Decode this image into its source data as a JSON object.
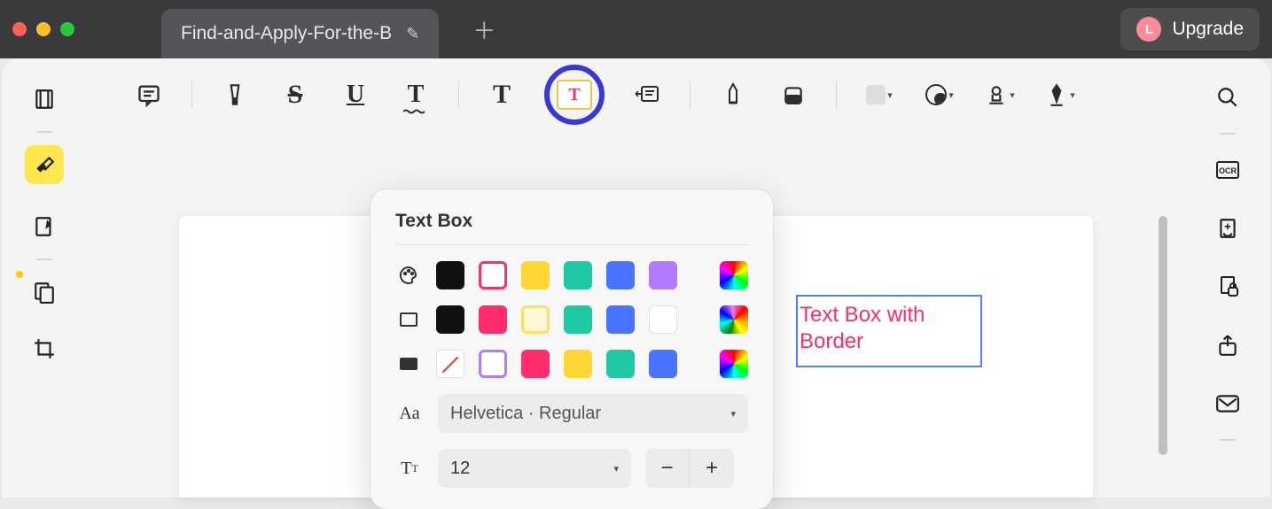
{
  "window": {
    "tab_title": "Find-and-Apply-For-the-B",
    "upgrade_label": "Upgrade",
    "avatar_letter": "L"
  },
  "popover": {
    "title": "Text Box",
    "font_label": "Helvetica · Regular",
    "size_value": "12",
    "text_colors": [
      "#111111",
      "#ff2d6b",
      "#ffd633",
      "#1ec9a3",
      "#4a74ff",
      "#b27aff"
    ],
    "text_color_selected": 1,
    "border_colors": [
      "#111111",
      "#ff2d6b",
      "#ffe066",
      "#1ec9a3",
      "#4a74ff",
      "#ffffff"
    ],
    "border_color_selected": 2,
    "fill_colors": [
      "none",
      "#b27aff_outline",
      "#ff2d6b",
      "#ffd633",
      "#1ec9a3",
      "#4a74ff"
    ]
  },
  "document": {
    "textbox_content": "Text Box with Border"
  }
}
